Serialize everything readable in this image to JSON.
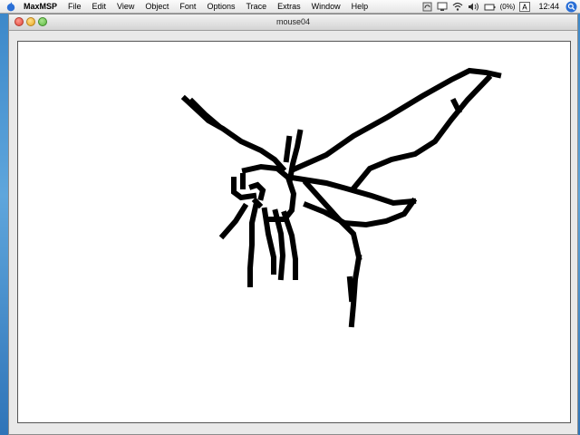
{
  "menubar": {
    "app_name": "MaxMSP",
    "items": [
      "File",
      "Edit",
      "View",
      "Object",
      "Font",
      "Options",
      "Trace",
      "Extras",
      "Window",
      "Help"
    ],
    "battery_text": "(0%)",
    "clock": "12:44"
  },
  "window": {
    "title": "mouse04"
  },
  "drawing": {
    "content": "freehand mouse drawing",
    "stroke_color": "#000000"
  }
}
